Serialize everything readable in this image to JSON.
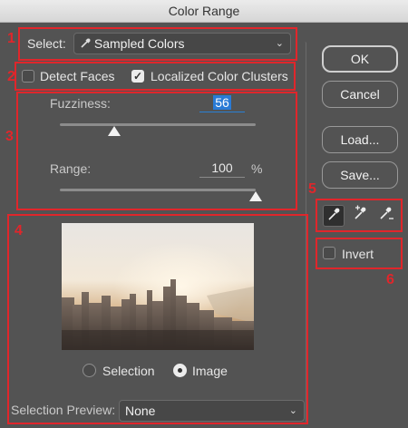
{
  "window": {
    "title": "Color Range"
  },
  "annotations": [
    "1",
    "2",
    "3",
    "4",
    "5",
    "6"
  ],
  "select": {
    "label": "Select:",
    "value": "Sampled Colors"
  },
  "options": {
    "detect_faces": {
      "label": "Detect Faces",
      "checked": false
    },
    "localized_color_clusters": {
      "label": "Localized Color Clusters",
      "checked": true
    }
  },
  "fuzziness": {
    "label": "Fuzziness:",
    "value": "56",
    "level": 0.28
  },
  "range": {
    "label": "Range:",
    "value": "100",
    "unit": "%",
    "level": 1.0
  },
  "buttons": {
    "ok": "OK",
    "cancel": "Cancel",
    "load": "Load...",
    "save": "Save..."
  },
  "eyedroppers": [
    {
      "icon": "eyedropper-icon",
      "active": true
    },
    {
      "icon": "eyedropper-plus-icon",
      "active": false
    },
    {
      "icon": "eyedropper-minus-icon",
      "active": false
    }
  ],
  "invert": {
    "label": "Invert",
    "checked": false
  },
  "view": {
    "selection_label": "Selection",
    "image_label": "Image",
    "selected": "Image"
  },
  "selection_preview": {
    "label": "Selection Preview:",
    "value": "None"
  }
}
